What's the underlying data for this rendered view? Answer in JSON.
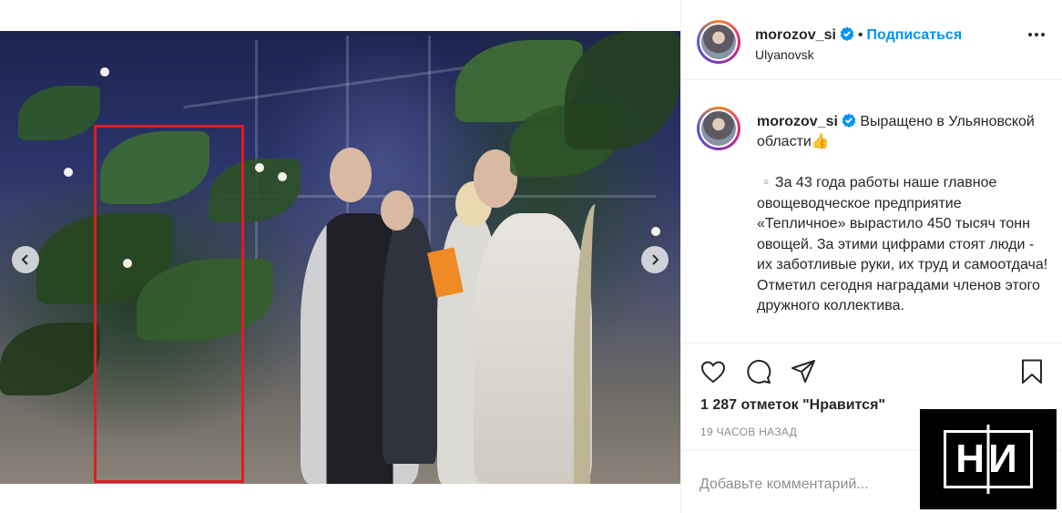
{
  "photo": {
    "carousel_position": "5 of 8",
    "highlight_color": "#e11b22",
    "prev_icon": "chevron-left-icon",
    "next_icon": "chevron-right-icon"
  },
  "post_header": {
    "username": "morozov_si",
    "separator": "•",
    "follow_label": "Подписаться",
    "location": "Ulyanovsk",
    "more_icon": "more-options-icon",
    "verified_icon": "verified-badge-icon",
    "accent_color": "#0095f6"
  },
  "caption": {
    "username": "morozov_si",
    "first_line": "Выращено в Ульяновской области👍",
    "body": "▫️За 43 года работы наше главное овощеводческое предприятие «Тепличное» вырастило 450 тысяч тонн овощей. За этими цифрами стоят люди - их заботливые руки, их труд и самоотдача! Отметил сегодня наградами членов этого дружного коллектива."
  },
  "actions": {
    "like_icon": "heart-icon",
    "comment_icon": "comment-icon",
    "share_icon": "share-icon",
    "save_icon": "bookmark-icon",
    "likes_text": "1 287 отметок \"Нравится\"",
    "time_text": "19 ЧАСОВ НАЗАД"
  },
  "comment": {
    "placeholder": "Добавьте комментарий..."
  },
  "watermark": {
    "text": "НИ"
  }
}
